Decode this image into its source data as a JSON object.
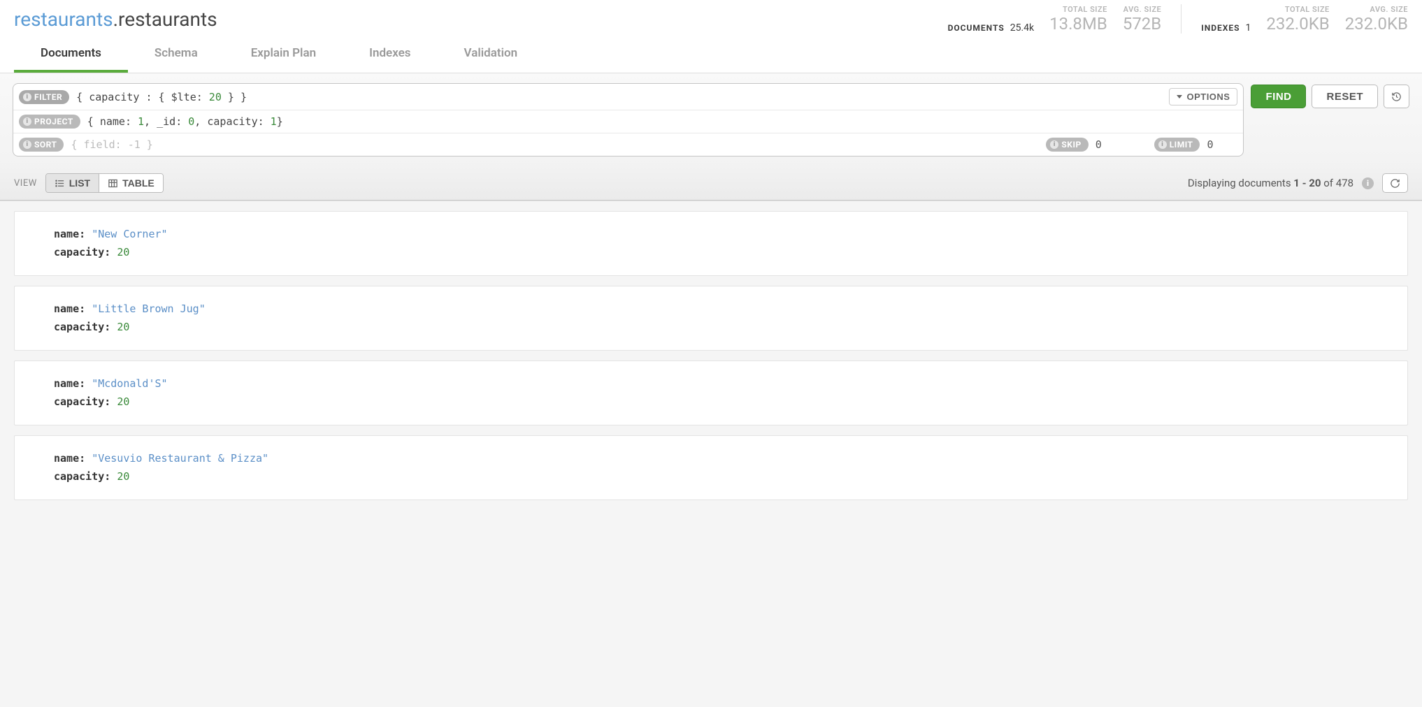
{
  "breadcrumb": {
    "db": "restaurants",
    "coll": "restaurants"
  },
  "stats": {
    "documents_label": "DOCUMENTS",
    "documents_value": "25.4k",
    "doc_total_size_label": "TOTAL SIZE",
    "doc_total_size_value": "13.8MB",
    "doc_avg_size_label": "AVG. SIZE",
    "doc_avg_size_value": "572B",
    "indexes_label": "INDEXES",
    "indexes_value": "1",
    "idx_total_size_label": "TOTAL SIZE",
    "idx_total_size_value": "232.0KB",
    "idx_avg_size_label": "AVG. SIZE",
    "idx_avg_size_value": "232.0KB"
  },
  "tabs": {
    "documents": "Documents",
    "schema": "Schema",
    "explain": "Explain Plan",
    "indexes": "Indexes",
    "validation": "Validation"
  },
  "query": {
    "filter_label": "FILTER",
    "filter_prefix": "{ capacity : { $lte: ",
    "filter_num": "20",
    "filter_suffix": " } }",
    "project_label": "PROJECT",
    "project_p1": "{ name: ",
    "project_n1": "1",
    "project_p2": ", _id: ",
    "project_n2": "0",
    "project_p3": ", capacity: ",
    "project_n3": "1",
    "project_p4": "}",
    "sort_label": "SORT",
    "sort_placeholder": "{ field: -1 }",
    "skip_label": "SKIP",
    "skip_value": "0",
    "limit_label": "LIMIT",
    "limit_value": "0",
    "options_label": "OPTIONS",
    "find_label": "FIND",
    "reset_label": "RESET"
  },
  "view": {
    "label": "VIEW",
    "list": "LIST",
    "table": "TABLE",
    "display_prefix": "Displaying documents ",
    "range": "1 - 20",
    "of": " of ",
    "total": "478"
  },
  "documents": [
    {
      "name": "New Corner",
      "capacity": 20
    },
    {
      "name": "Little Brown Jug",
      "capacity": 20
    },
    {
      "name": "Mcdonald'S",
      "capacity": 20
    },
    {
      "name": "Vesuvio Restaurant & Pizza",
      "capacity": 20
    }
  ],
  "field_labels": {
    "name": "name",
    "capacity": "capacity"
  }
}
